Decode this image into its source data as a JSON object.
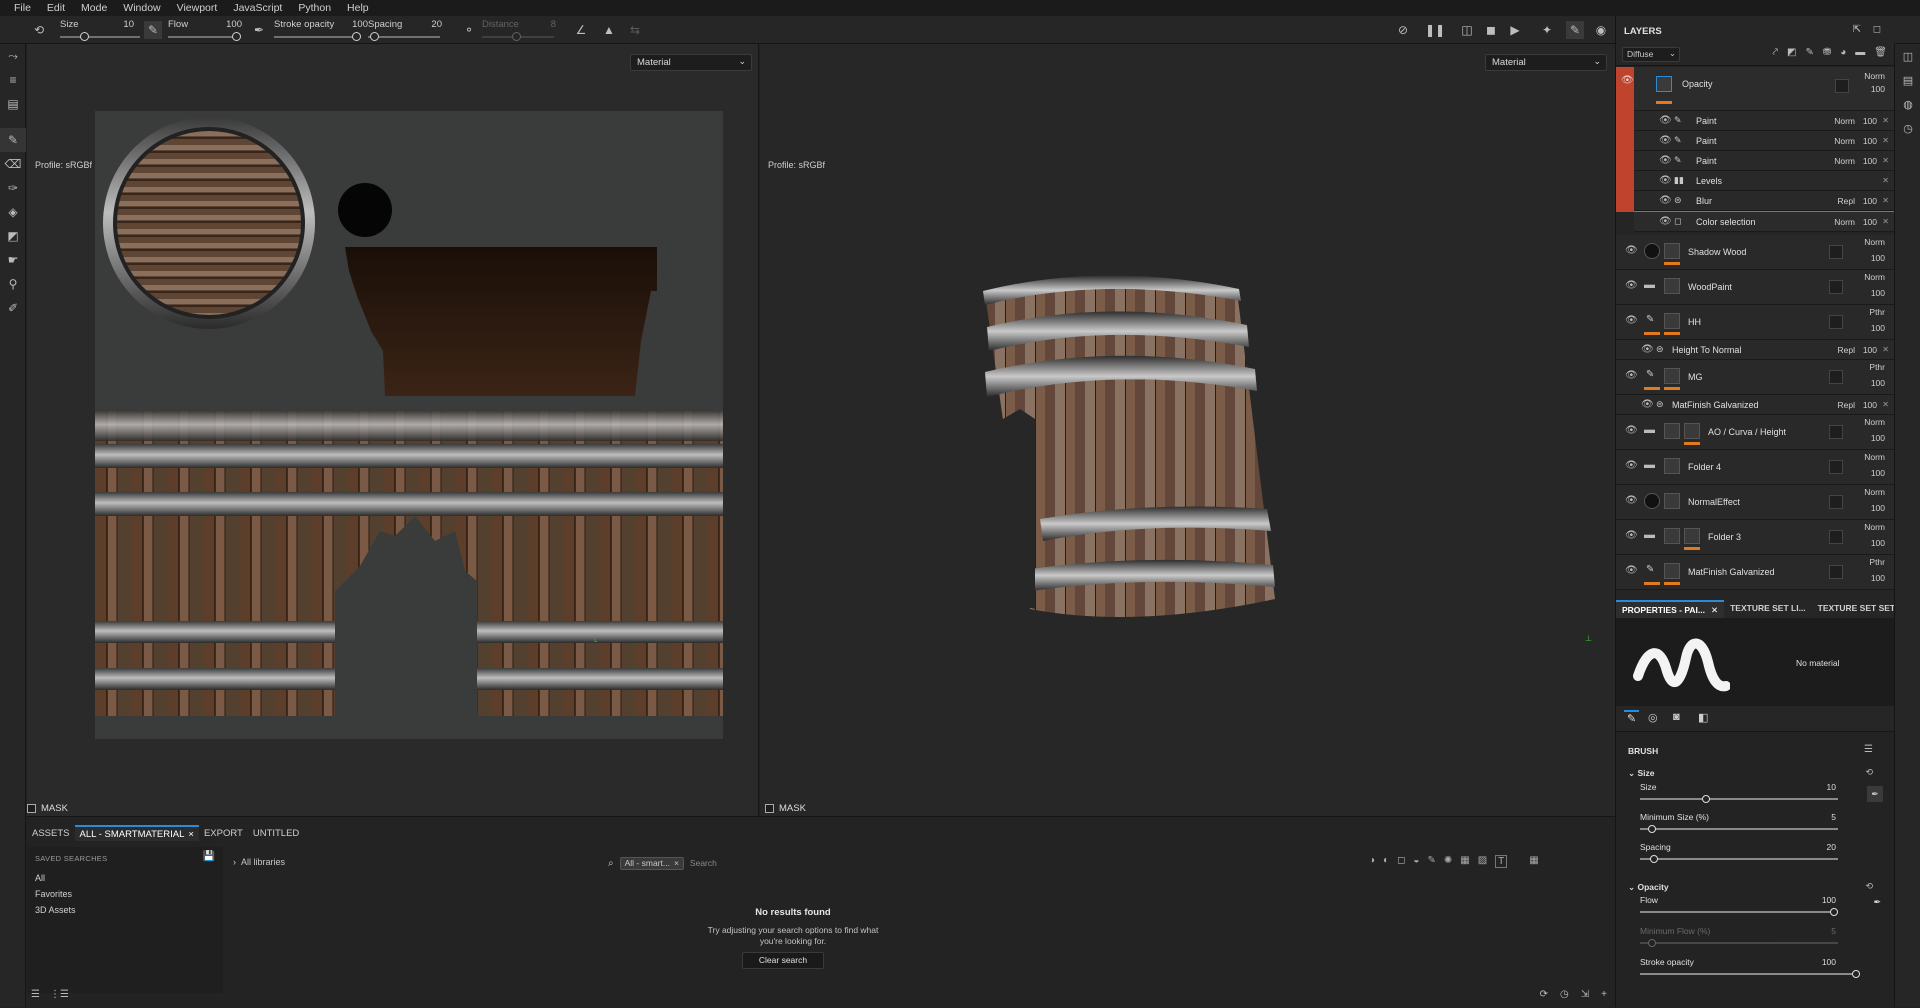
{
  "menu": [
    "File",
    "Edit",
    "Mode",
    "Window",
    "Viewport",
    "JavaScript",
    "Python",
    "Help"
  ],
  "toolbar": {
    "size_label": "Size",
    "size_value": "10",
    "flow_label": "Flow",
    "flow_value": "100",
    "stroke_label": "Stroke opacity",
    "stroke_value": "100",
    "spacing_label": "Spacing",
    "spacing_value": "20",
    "distance_label": "Distance",
    "distance_value": "8"
  },
  "viewport2d": {
    "dropdown": "Material",
    "profile": "Profile: sRGBf",
    "mask": "MASK"
  },
  "viewport3d": {
    "dropdown": "Material",
    "profile": "Profile: sRGBf",
    "mask": "MASK"
  },
  "layers": {
    "title": "LAYERS",
    "channel": "Diffuse",
    "items": [
      {
        "name": "Opacity",
        "blend": "Norm",
        "value": "100"
      },
      {
        "name": "Paint",
        "blend": "Norm",
        "value": "100"
      },
      {
        "name": "Paint",
        "blend": "Norm",
        "value": "100"
      },
      {
        "name": "Paint",
        "blend": "Norm",
        "value": "100"
      },
      {
        "name": "Levels",
        "blend": "",
        "value": ""
      },
      {
        "name": "Blur",
        "blend": "Repl",
        "value": "100"
      },
      {
        "name": "Color selection",
        "blend": "Norm",
        "value": "100"
      },
      {
        "name": "Shadow Wood",
        "blend": "Norm",
        "value": "100"
      },
      {
        "name": "WoodPaint",
        "blend": "Norm",
        "value": "100"
      },
      {
        "name": "HH",
        "blend": "Pthr",
        "value": "100"
      },
      {
        "name": "Height To Normal",
        "blend": "Repl",
        "value": "100"
      },
      {
        "name": "MG",
        "blend": "Pthr",
        "value": "100"
      },
      {
        "name": "MatFinish Galvanized",
        "blend": "Repl",
        "value": "100"
      },
      {
        "name": "AO / Curva / Height",
        "blend": "Norm",
        "value": "100"
      },
      {
        "name": "Folder 4",
        "blend": "Norm",
        "value": "100"
      },
      {
        "name": "NormalEffect",
        "blend": "Norm",
        "value": "100"
      },
      {
        "name": "Folder 3",
        "blend": "Norm",
        "value": "100"
      },
      {
        "name": "MatFinish Galvanized",
        "blend": "Pthr",
        "value": "100"
      }
    ]
  },
  "properties": {
    "tabs": [
      "PROPERTIES - PAI...",
      "TEXTURE SET LI...",
      "TEXTURE SET SETTIN..."
    ],
    "no_material": "No material",
    "brush_title": "BRUSH",
    "size_section": "Size",
    "size_label": "Size",
    "size_value": "10",
    "min_size_label": "Minimum Size (%)",
    "min_size_value": "5",
    "spacing_label": "Spacing",
    "spacing_value": "20",
    "opacity_section": "Opacity",
    "flow_label": "Flow",
    "flow_value": "100",
    "min_flow_label": "Minimum Flow (%)",
    "min_flow_value": "5",
    "stroke_label": "Stroke opacity",
    "stroke_value": "100"
  },
  "assets": {
    "tabs": [
      "ASSETS",
      "ALL - SMARTMATERIAL",
      "EXPORT",
      "UNTITLED"
    ],
    "saved_searches": "SAVED SEARCHES",
    "saved": [
      "All",
      "Favorites",
      "3D Assets"
    ],
    "breadcrumb": "All libraries",
    "filter_pill": "All - smart...",
    "search_placeholder": "Search",
    "no_results": "No results found",
    "hint_line1": "Try adjusting your search options to find what",
    "hint_line2": "you're looking for.",
    "clear_button": "Clear search"
  },
  "colors": {
    "accent": "#2a8bd6",
    "orange": "#e07a1f",
    "selected_group": "#c0432d"
  }
}
